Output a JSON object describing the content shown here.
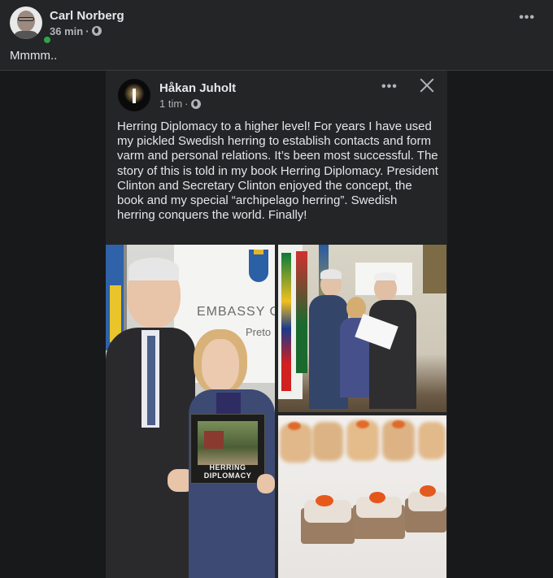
{
  "outer_post": {
    "author": "Carl Norberg",
    "time": "36 min",
    "text": "Mmmm..",
    "more_label": "•••"
  },
  "shared_post": {
    "author": "Håkan Juholt",
    "time": "1 tim",
    "more_label": "•••",
    "body": "Herring Diplomacy to a higher level! For years I have used my pickled Swedish herring to establish contacts and form varm and personal relations. It’s been most successful. The story of this is told in my book Herring Diplomacy. President Clinton and Secretary Clinton enjoyed the concept, the book and my special “archipelago herring”.  Swedish herring conquers the world. Finally!"
  },
  "photo_main": {
    "banner_text": "EMBASSY O",
    "banner_subtext": "Preto",
    "book_title": "HERRING DIPLOMACY"
  },
  "icons": {
    "privacy": "globe-icon",
    "close": "close-icon",
    "more": "more-options-icon",
    "online": "online-status-dot"
  },
  "colors": {
    "background": "#242526",
    "text_primary": "#e4e6eb",
    "text_secondary": "#b0b3b8",
    "online": "#31a24c"
  }
}
